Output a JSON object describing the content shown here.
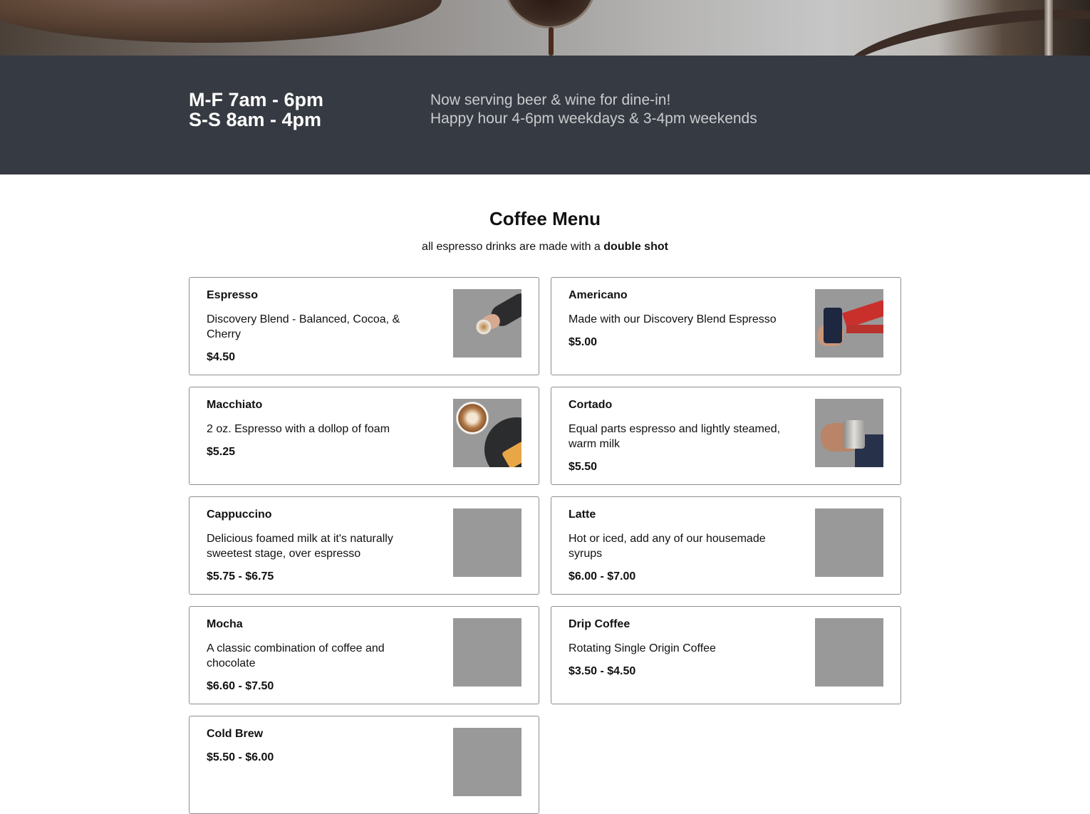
{
  "hours": {
    "weekdays": "M-F 7am - 6pm",
    "weekends": "S-S 8am - 4pm"
  },
  "announcement": {
    "line1": "Now serving beer & wine for dine-in!",
    "line2": "Happy hour 4-6pm weekdays & 3-4pm weekends"
  },
  "menu": {
    "title": "Coffee Menu",
    "subtitle_prefix": "all espresso drinks are made with a ",
    "subtitle_bold": "double shot",
    "items": [
      {
        "name": "Espresso",
        "description": "Discovery Blend - Balanced, Cocoa, & Cherry",
        "price": "$4.50"
      },
      {
        "name": "Americano",
        "description": "Made with our Discovery Blend Espresso",
        "price": "$5.00"
      },
      {
        "name": "Macchiato",
        "description": "2 oz. Espresso with a dollop of foam",
        "price": "$5.25"
      },
      {
        "name": "Cortado",
        "description": "Equal parts espresso and lightly steamed, warm milk",
        "price": "$5.50"
      },
      {
        "name": "Cappuccino",
        "description": "Delicious foamed milk at it's naturally sweetest stage, over espresso",
        "price": "$5.75 - $6.75"
      },
      {
        "name": "Latte",
        "description": "Hot or iced, add any of our housemade syrups",
        "price": "$6.00 - $7.00"
      },
      {
        "name": "Mocha",
        "description": "A classic combination of coffee and chocolate",
        "price": "$6.60 - $7.50"
      },
      {
        "name": "Drip Coffee",
        "description": "Rotating Single Origin Coffee",
        "price": "$3.50 - $4.50"
      },
      {
        "name": "Cold Brew",
        "description": "",
        "price": "$5.50 - $6.00"
      }
    ]
  },
  "colors": {
    "hours_band": "#363a42",
    "card_border": "#8d8d8d",
    "placeholder_image": "#999999"
  }
}
